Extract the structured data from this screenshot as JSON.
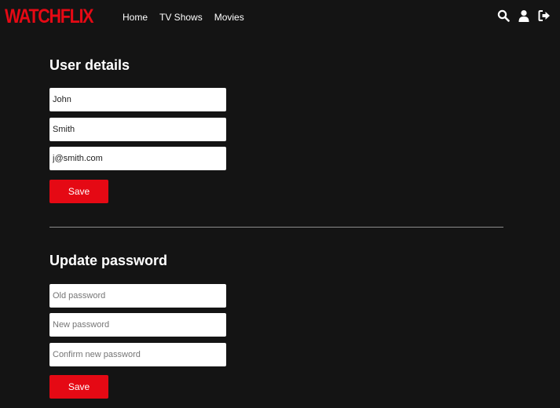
{
  "brand": {
    "logo_text": "WATCHFLIX",
    "accent_color": "#e50914"
  },
  "nav": {
    "links": [
      {
        "label": "Home"
      },
      {
        "label": "TV Shows"
      },
      {
        "label": "Movies"
      }
    ],
    "icons": [
      "search-icon",
      "user-icon",
      "logout-icon"
    ]
  },
  "user_details": {
    "title": "User details",
    "first_name": "John",
    "last_name": "Smith",
    "email": "j@smith.com",
    "save_label": "Save"
  },
  "update_password": {
    "title": "Update password",
    "old_placeholder": "Old password",
    "new_placeholder": "New password",
    "confirm_placeholder": "Confirm new password",
    "save_label": "Save"
  }
}
